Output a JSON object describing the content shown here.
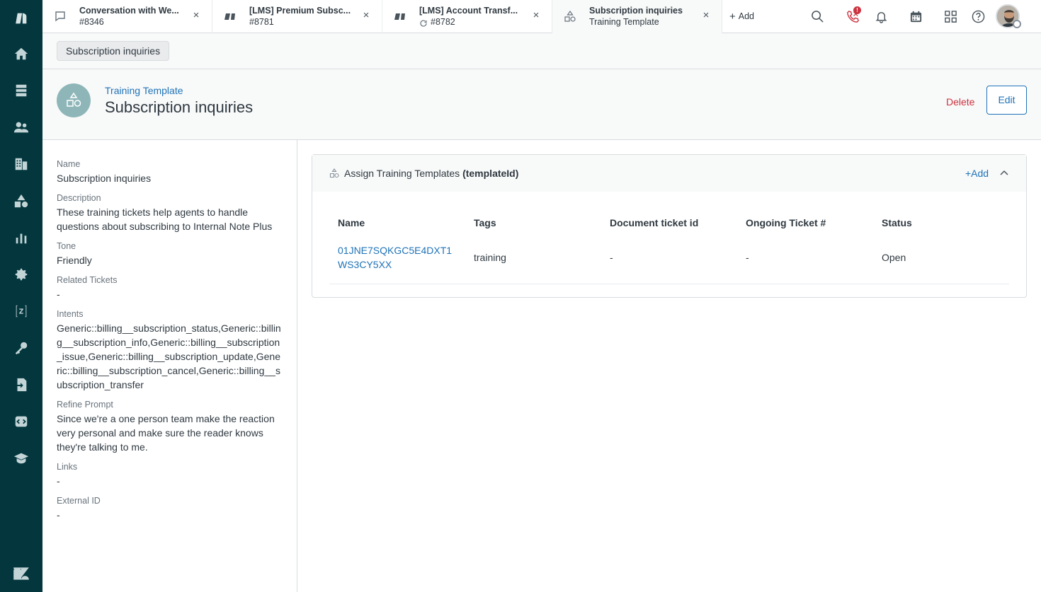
{
  "nav": {
    "items": [
      "home-icon",
      "views-icon",
      "customers-icon",
      "organizations-icon",
      "shapes-icon",
      "reporting-icon",
      "admin-gear-icon",
      "zendesk-marketplace-icon",
      "key-icon",
      "import-icon",
      "code-icon",
      "training-cap-icon"
    ]
  },
  "tabs": [
    {
      "title": "Conversation with We...",
      "sub": "#8346",
      "icon": "chat-bubble-icon"
    },
    {
      "title": "[LMS] Premium Subsc...",
      "sub": "#8781",
      "icon": "ticket-icon"
    },
    {
      "title": "[LMS] Account Transf...",
      "sub": "#8782",
      "icon": "ticket-icon"
    },
    {
      "title": "Subscription inquiries",
      "sub": "Training Template",
      "icon": "shapes-icon"
    }
  ],
  "topbar": {
    "add_label": "Add",
    "phone_badge": "!"
  },
  "breadcrumb": {
    "label": "Subscription inquiries"
  },
  "header": {
    "type_label": "Training Template",
    "title": "Subscription inquiries",
    "delete_label": "Delete",
    "edit_label": "Edit"
  },
  "details": {
    "name_label": "Name",
    "name_value": "Subscription inquiries",
    "description_label": "Description",
    "description_value": "These training tickets help agents to handle questions about subscribing to Internal Note Plus",
    "tone_label": "Tone",
    "tone_value": "Friendly",
    "related_label": "Related Tickets",
    "related_value": "-",
    "intents_label": "Intents",
    "intents_value": "Generic::billing__subscription_status,Generic::billing__subscription_info,Generic::billing__subscription_issue,Generic::billing__subscription_update,Generic::billing__subscription_cancel,Generic::billing__subscription_transfer",
    "refine_label": "Refine Prompt",
    "refine_value": "Since we're a one person team make the reaction very personal and make sure the reader knows they're talking to me.",
    "links_label": "Links",
    "links_value": "-",
    "external_label": "External ID",
    "external_value": "-"
  },
  "card": {
    "title_prefix": "Assign Training Templates",
    "title_bold": "(templateId)",
    "add_label": "+Add",
    "columns": [
      "Name",
      "Tags",
      "Document ticket id",
      "Ongoing Ticket #",
      "Status"
    ],
    "rows": [
      {
        "name_line1": "01JNE7SQKGC5E4DXT1",
        "name_line2": "WS3CY5XX",
        "tags": "training",
        "doc_ticket": "-",
        "ongoing": "-",
        "status": "Open"
      }
    ]
  },
  "colors": {
    "nav_bg": "#03363d",
    "link": "#1f73b7",
    "danger": "#cc3340",
    "avatar_teal": "#8eb6b9"
  }
}
